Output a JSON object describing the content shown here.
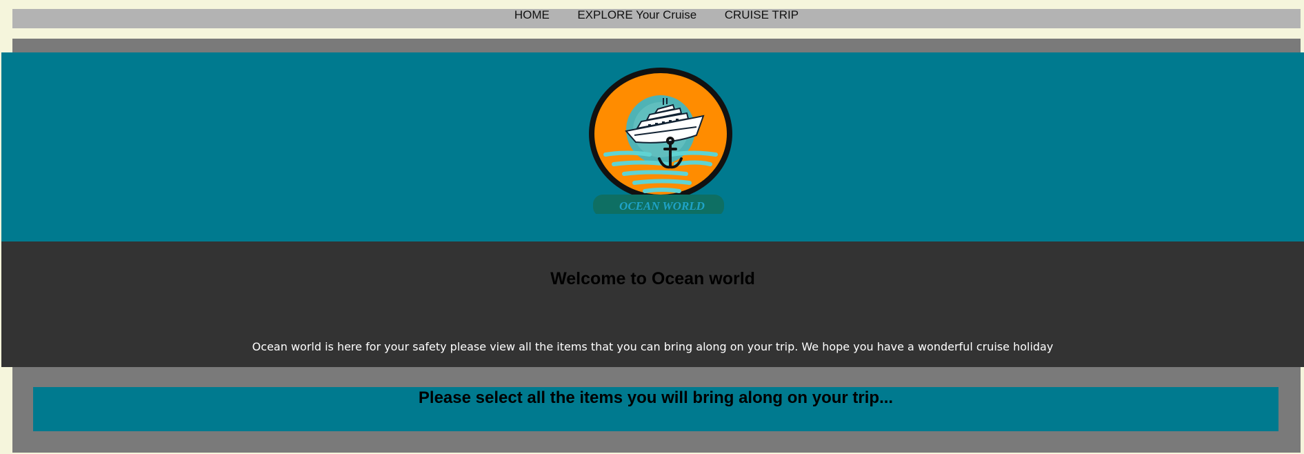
{
  "nav": {
    "items": [
      {
        "label": "HOME"
      },
      {
        "label": "EXPLORE Your Cruise"
      },
      {
        "label": "CRUISE TRIP"
      }
    ]
  },
  "logo": {
    "brand_text": "OCEAN WORLD",
    "icon": "cruise-ship-anchor-logo"
  },
  "welcome": {
    "title": "Welcome to Ocean world",
    "text": "Ocean world is here for your safety please view all the items that you can bring along on your trip. We hope you have a wonderful cruise holiday"
  },
  "selection": {
    "heading": "Please select all the items you will bring along on your trip..."
  },
  "colors": {
    "page_bg": "#f5f5dc",
    "nav_bg": "#b3b3b3",
    "frame_bg": "#7a7a7a",
    "teal": "#007a8f",
    "dark": "#333333",
    "logo_orange": "#ff8c00"
  }
}
